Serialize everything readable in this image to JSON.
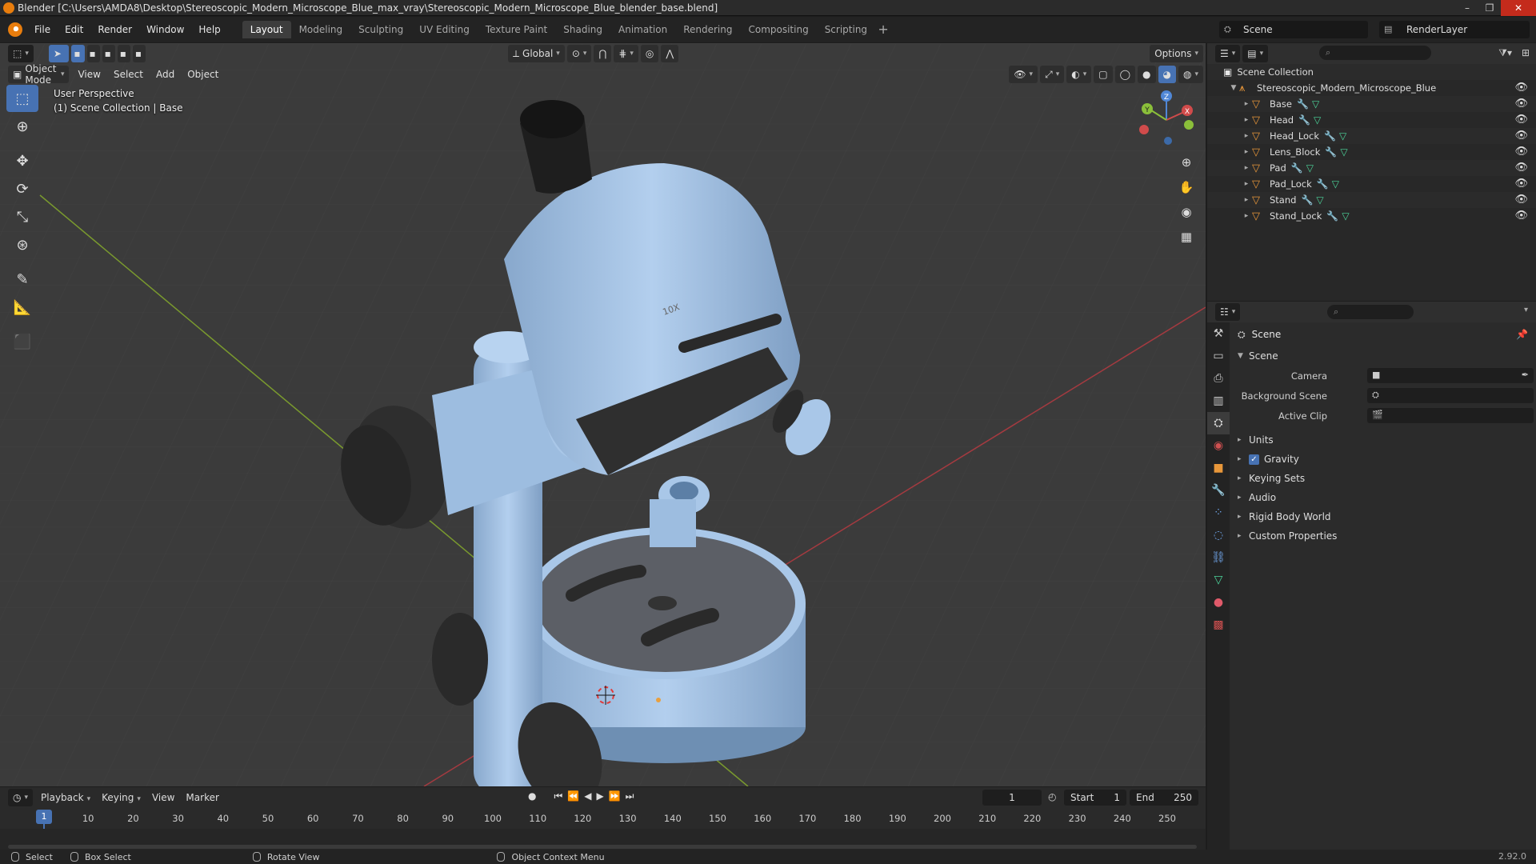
{
  "window": {
    "title": "Blender [C:\\Users\\AMDA8\\Desktop\\Stereoscopic_Modern_Microscope_Blue_max_vray\\Stereoscopic_Modern_Microscope_Blue_blender_base.blend]",
    "minimize": "–",
    "maximize": "❐",
    "close": "✕"
  },
  "menu": [
    "File",
    "Edit",
    "Render",
    "Window",
    "Help"
  ],
  "workspaces": [
    "Layout",
    "Modeling",
    "Sculpting",
    "UV Editing",
    "Texture Paint",
    "Shading",
    "Animation",
    "Rendering",
    "Compositing",
    "Scripting"
  ],
  "workspace_add": "+",
  "active_workspace": "Layout",
  "scene_name": "Scene",
  "render_layer": "RenderLayer",
  "viewport": {
    "transform_orientation": "Global",
    "options_label": "Options",
    "mode": "Object Mode",
    "menus": [
      "View",
      "Select",
      "Add",
      "Object"
    ],
    "perspective": "User Perspective",
    "collection_info": "(1) Scene Collection | Base",
    "lens_label": "10X",
    "gizmo_axes": {
      "x": "X",
      "y": "Y",
      "z": "Z"
    }
  },
  "outliner": {
    "root": "Scene Collection",
    "collection": "Stereoscopic_Modern_Microscope_Blue",
    "objects": [
      "Base",
      "Head",
      "Head_Lock",
      "Lens_Block",
      "Pad",
      "Pad_Lock",
      "Stand",
      "Stand_Lock"
    ]
  },
  "properties": {
    "context_title": "Scene",
    "panel_scene": "Scene",
    "camera_label": "Camera",
    "background_scene_label": "Background Scene",
    "active_clip_label": "Active Clip",
    "panels": [
      "Units",
      "Gravity",
      "Keying Sets",
      "Audio",
      "Rigid Body World",
      "Custom Properties"
    ],
    "gravity_checked": true
  },
  "timeline": {
    "menus": [
      "Playback",
      "Keying",
      "View",
      "Marker"
    ],
    "current_frame": "1",
    "start_label": "Start",
    "start_value": "1",
    "end_label": "End",
    "end_value": "250",
    "ticks": [
      "10",
      "20",
      "30",
      "40",
      "50",
      "60",
      "70",
      "80",
      "90",
      "100",
      "110",
      "120",
      "130",
      "140",
      "150",
      "160",
      "170",
      "180",
      "190",
      "200",
      "210",
      "220",
      "230",
      "240",
      "250"
    ],
    "playhead_value": "1"
  },
  "statusbar": {
    "select": "Select",
    "box_select": "Box Select",
    "rotate_view": "Rotate View",
    "context_menu": "Object Context Menu",
    "version": "2.92.0"
  },
  "colors": {
    "accent": "#4772b3",
    "model_body": "#a9c7e8",
    "model_dark": "#2f2f2f",
    "viewport_bg": "#3a3a3a"
  }
}
